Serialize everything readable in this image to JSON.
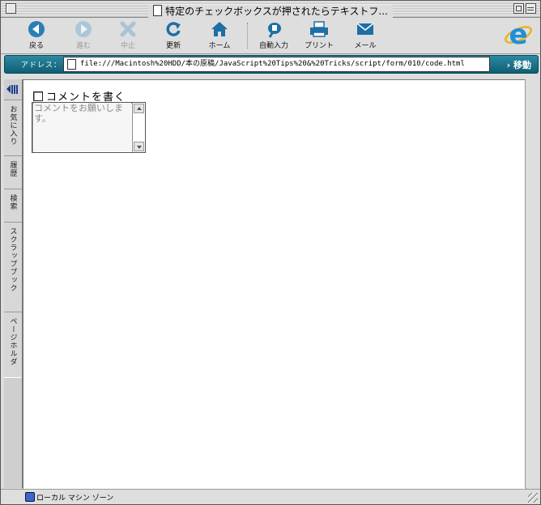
{
  "window": {
    "title": "特定のチェックボックスが押されたらテキストフ..."
  },
  "toolbar": {
    "buttons": [
      {
        "label": "戻る",
        "icon": "back-arrow-icon",
        "enabled": true
      },
      {
        "label": "進む",
        "icon": "forward-arrow-icon",
        "enabled": false
      },
      {
        "label": "中止",
        "icon": "stop-x-icon",
        "enabled": false
      },
      {
        "label": "更新",
        "icon": "refresh-icon",
        "enabled": true
      },
      {
        "label": "ホーム",
        "icon": "home-icon",
        "enabled": true
      },
      {
        "label": "自動入力",
        "icon": "autofill-icon",
        "enabled": true
      },
      {
        "label": "プリント",
        "icon": "printer-icon",
        "enabled": true
      },
      {
        "label": "メール",
        "icon": "mail-icon",
        "enabled": true
      }
    ]
  },
  "address": {
    "label": "アドレス：",
    "url": "file:///Macintosh%20HDD/本の原稿/JavaScript%20Tips%20&%20Tricks/script/form/010/code.html",
    "go_label": "移動"
  },
  "explorer": {
    "tabs": [
      "お気に入り",
      "履歴",
      "検索",
      "スクラップブック",
      "ページホルダ"
    ]
  },
  "page": {
    "checkbox_label": "コメントを書く",
    "checkbox_checked": false,
    "textarea_value": "コメントをお願いします。"
  },
  "status": {
    "zone": "ローカル マシン ゾーン"
  },
  "colors": {
    "address_bar": "#1b6f86",
    "ie_logo": "#1f8fd8"
  }
}
